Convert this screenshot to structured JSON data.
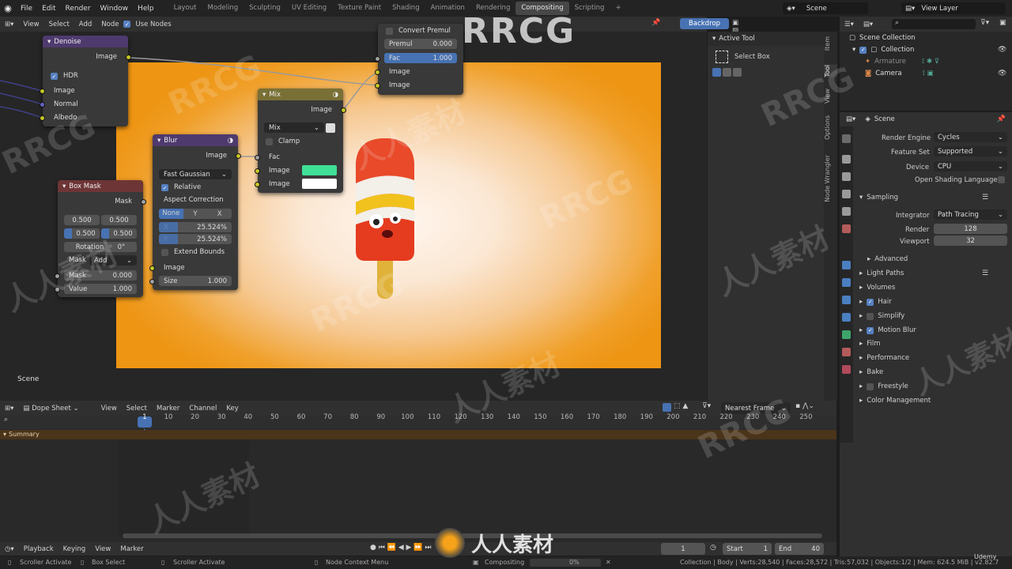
{
  "top_menu": [
    "File",
    "Edit",
    "Render",
    "Window",
    "Help"
  ],
  "workspaces": [
    "Layout",
    "Modeling",
    "Sculpting",
    "UV Editing",
    "Texture Paint",
    "Shading",
    "Animation",
    "Rendering",
    "Compositing",
    "Scripting"
  ],
  "active_workspace": "Compositing",
  "scene_name": "Scene",
  "view_layer": "View Layer",
  "node_header": {
    "menus": [
      "View",
      "Select",
      "Add",
      "Node"
    ],
    "use_nodes": "Use Nodes",
    "backdrop": "Backdrop"
  },
  "nodes": {
    "denoise": {
      "title": "Denoise",
      "output": "Image",
      "hdr": "HDR",
      "inputs": [
        "Image",
        "Normal",
        "Albedo"
      ]
    },
    "blur": {
      "title": "Blur",
      "output": "Image",
      "type": "Fast Gaussian",
      "relative": "Relative",
      "aspect": "Aspect Correction",
      "aspect_opts": [
        "None",
        "Y",
        "X"
      ],
      "x_label": "X",
      "x_val": "25.524%",
      "y_label": "Y",
      "y_val": "25.524%",
      "extend": "Extend Bounds",
      "in_image": "Image",
      "size_label": "Size",
      "size_val": "1.000"
    },
    "mix": {
      "title": "Mix",
      "output": "Image",
      "blend": "Mix",
      "clamp": "Clamp",
      "fac": "Fac",
      "image1": "Image",
      "image2": "Image"
    },
    "boxmask": {
      "title": "Box Mask",
      "output": "Mask",
      "x": "0.500",
      "y": "0.500",
      "w": "0.500",
      "h": "0.500",
      "rot_label": "Rotation",
      "rot_val": "0°",
      "mask_label": "Mask",
      "mask_mode": "Add",
      "in_mask": "Mask",
      "in_mask_val": "0.000",
      "in_value": "Value",
      "in_value_val": "1.000"
    },
    "alphaover": {
      "convert": "Convert Premul",
      "premul": "Premul",
      "premul_val": "0.000",
      "fac": "Fac",
      "fac_val": "1.000",
      "image1": "Image",
      "image2": "Image"
    }
  },
  "node_scene_label": "Scene",
  "active_tool": {
    "title": "Active Tool",
    "tool": "Select Box"
  },
  "side_tabs": [
    "Item",
    "Tool",
    "View",
    "Options",
    "Node Wrangler"
  ],
  "outliner": {
    "root": "Scene Collection",
    "collection": "Collection",
    "items": [
      "Armature",
      "Camera"
    ]
  },
  "props": {
    "scene": "Scene",
    "render_engine_label": "Render Engine",
    "render_engine": "Cycles",
    "feature_set_label": "Feature Set",
    "feature_set": "Supported",
    "device_label": "Device",
    "device": "CPU",
    "osl": "Open Shading Language",
    "sampling": "Sampling",
    "integrator_label": "Integrator",
    "integrator": "Path Tracing",
    "render_label": "Render",
    "render_val": "128",
    "viewport_label": "Viewport",
    "viewport_val": "32",
    "advanced": "Advanced",
    "sections": [
      "Light Paths",
      "Volumes",
      "Hair",
      "Simplify",
      "Motion Blur",
      "Film",
      "Performance",
      "Bake",
      "Freestyle",
      "Color Management"
    ]
  },
  "dope": {
    "editor": "Dope Sheet",
    "menus": [
      "View",
      "Select",
      "Marker",
      "Channel",
      "Key"
    ],
    "snap": "Nearest Frame",
    "summary": "Summary",
    "frames": [
      "1",
      "10",
      "20",
      "30",
      "40",
      "50",
      "60",
      "70",
      "80",
      "90",
      "100",
      "110",
      "120",
      "130",
      "140",
      "150",
      "160",
      "170",
      "180",
      "190",
      "200",
      "210",
      "220",
      "230",
      "240",
      "250"
    ]
  },
  "timeline": {
    "menus": [
      "Playback",
      "Keying",
      "View",
      "Marker"
    ],
    "current": "1",
    "start_label": "Start",
    "start": "1",
    "end_label": "End",
    "end": "40"
  },
  "status": {
    "scroller": "Scroller Activate",
    "box": "Box Select",
    "scroller2": "Scroller Activate",
    "ctx": "Node Context Menu",
    "job": "Compositing",
    "job_pct": "0%",
    "stats": "Collection | Body | Verts:28,540 | Faces:28,572 | Tris:57,032 | Objects:1/2 | Mem: 624.5 MiB | v2.82.7"
  },
  "watermarks": [
    "RRCG",
    "人人素材",
    "RRCG",
    "人人素材",
    "RRCG",
    "人人素材",
    "RRCG",
    "人人素材",
    "RRCG",
    "人人素材",
    "RRCG",
    "人人素材"
  ],
  "brand": "人人素材",
  "udemy": "Udemy"
}
